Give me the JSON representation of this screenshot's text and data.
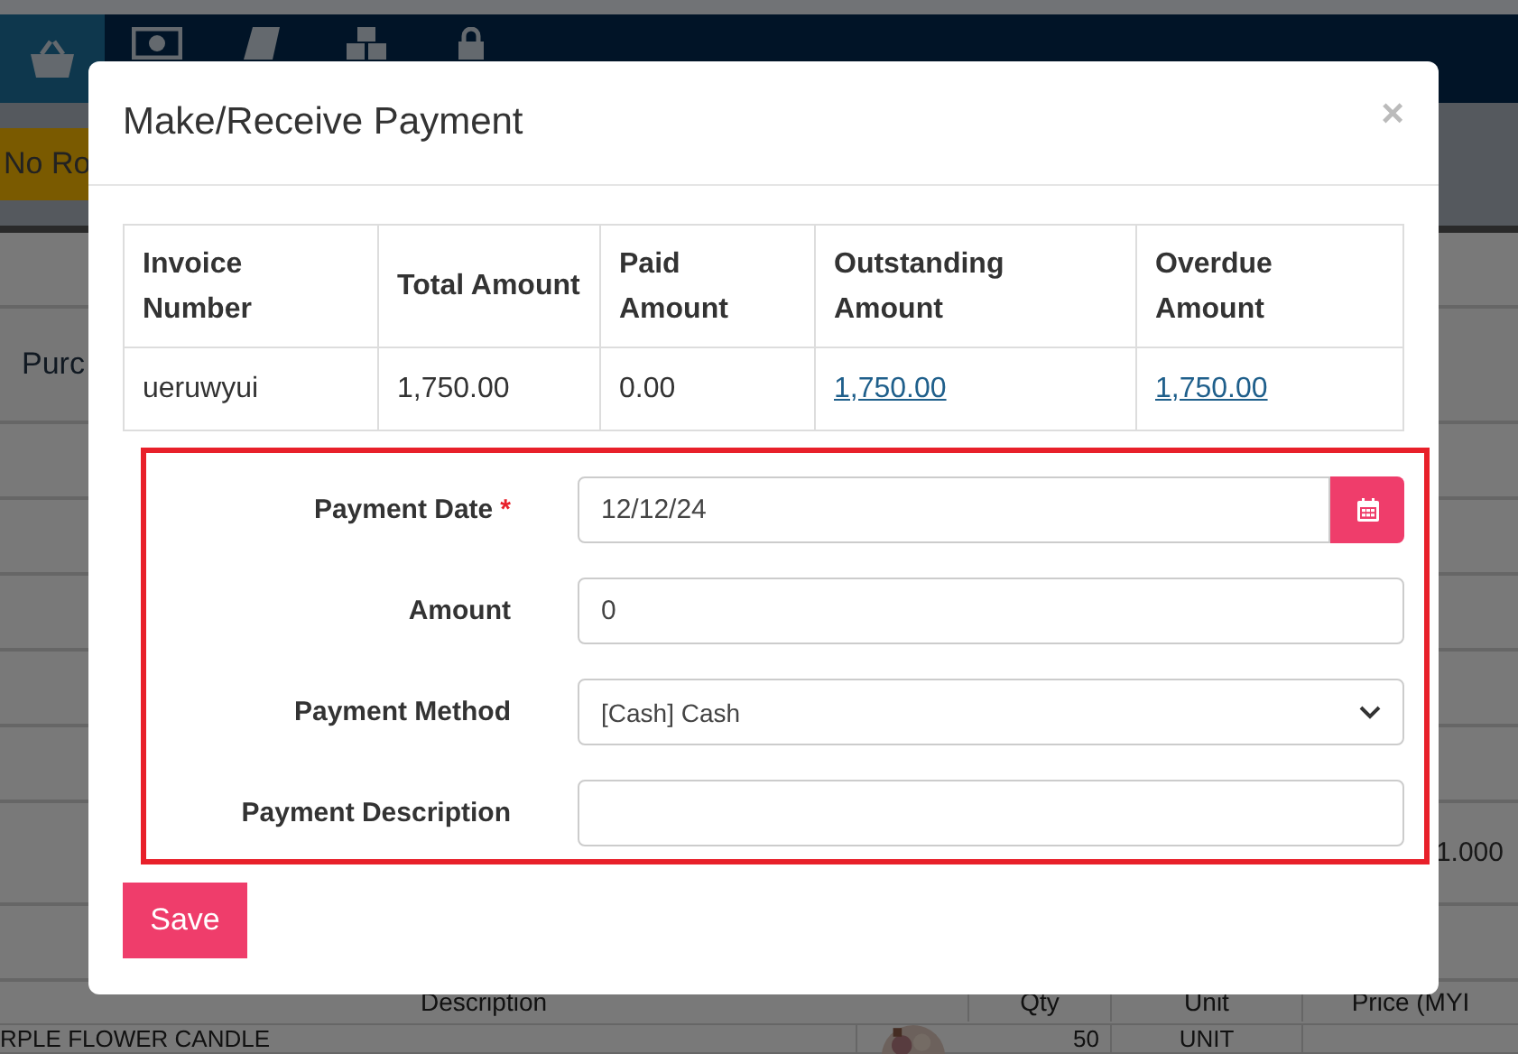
{
  "nav": {
    "items": [
      {
        "selected": true
      },
      {
        "selected": false
      },
      {
        "selected": false
      },
      {
        "selected": false
      },
      {
        "selected": false
      }
    ]
  },
  "page": {
    "toolbar_button": "No Ro",
    "breadcrumb": "Purc",
    "side_value": "1.000",
    "items_table": {
      "columns": [
        "Description",
        "Qty",
        "Unit",
        "Price (MYI"
      ],
      "rows": [
        {
          "cells": [
            "RPLE FLOWER CANDLE",
            "50",
            "UNIT"
          ]
        }
      ]
    }
  },
  "modal": {
    "title": "Make/Receive Payment",
    "close": "×",
    "table": {
      "columns": [
        "Invoice Number",
        "Total Amount",
        "Paid Amount",
        "Outstanding Amount",
        "Overdue Amount"
      ],
      "rows": [
        {
          "cells": [
            {
              "text": "ueruwyui",
              "link": false
            },
            {
              "text": "1,750.00",
              "link": false
            },
            {
              "text": "0.00",
              "link": false
            },
            {
              "text": "1,750.00",
              "link": true
            },
            {
              "text": "1,750.00",
              "link": true
            }
          ]
        }
      ]
    },
    "highlighted": true,
    "fields": [
      {
        "label": "Payment Date",
        "required": true,
        "kind": "date",
        "value": "12/12/24"
      },
      {
        "label": "Amount",
        "required": false,
        "kind": "text",
        "value": "0"
      },
      {
        "label": "Payment Method",
        "required": false,
        "kind": "select",
        "value": "[Cash] Cash"
      },
      {
        "label": "Payment Description",
        "required": false,
        "kind": "text"
      }
    ],
    "required_mark": "*",
    "save_button": "Save"
  }
}
